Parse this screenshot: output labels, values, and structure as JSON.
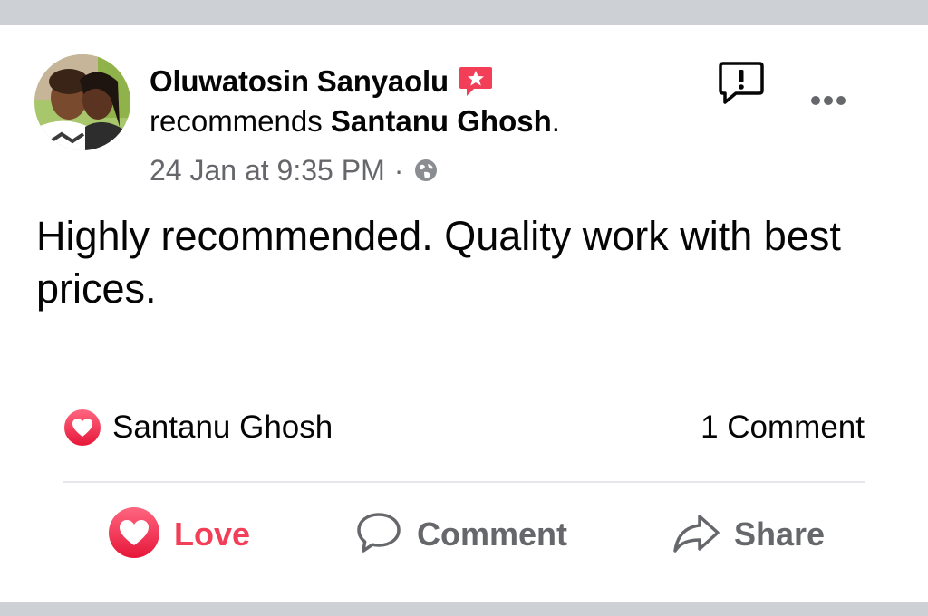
{
  "post": {
    "author": "Oluwatosin Sanyaolu",
    "action_text": "recommends",
    "target": "Santanu Ghosh",
    "target_suffix": ".",
    "timestamp": "24 Jan at 9:35 PM",
    "separator": "·",
    "privacy_icon": "globe-icon",
    "body": "Highly recommended. Quality work with best prices."
  },
  "reactions": {
    "icon": "love-icon",
    "names": "Santanu Ghosh",
    "comment_count_label": "1 Comment"
  },
  "actions": {
    "love_label": "Love",
    "comment_label": "Comment",
    "share_label": "Share"
  },
  "colors": {
    "love": "#f33e58",
    "secondary_text": "#65676b",
    "primary_text": "#050505",
    "divider": "#e4e6eb",
    "frame_band": "#cdd0d4"
  }
}
